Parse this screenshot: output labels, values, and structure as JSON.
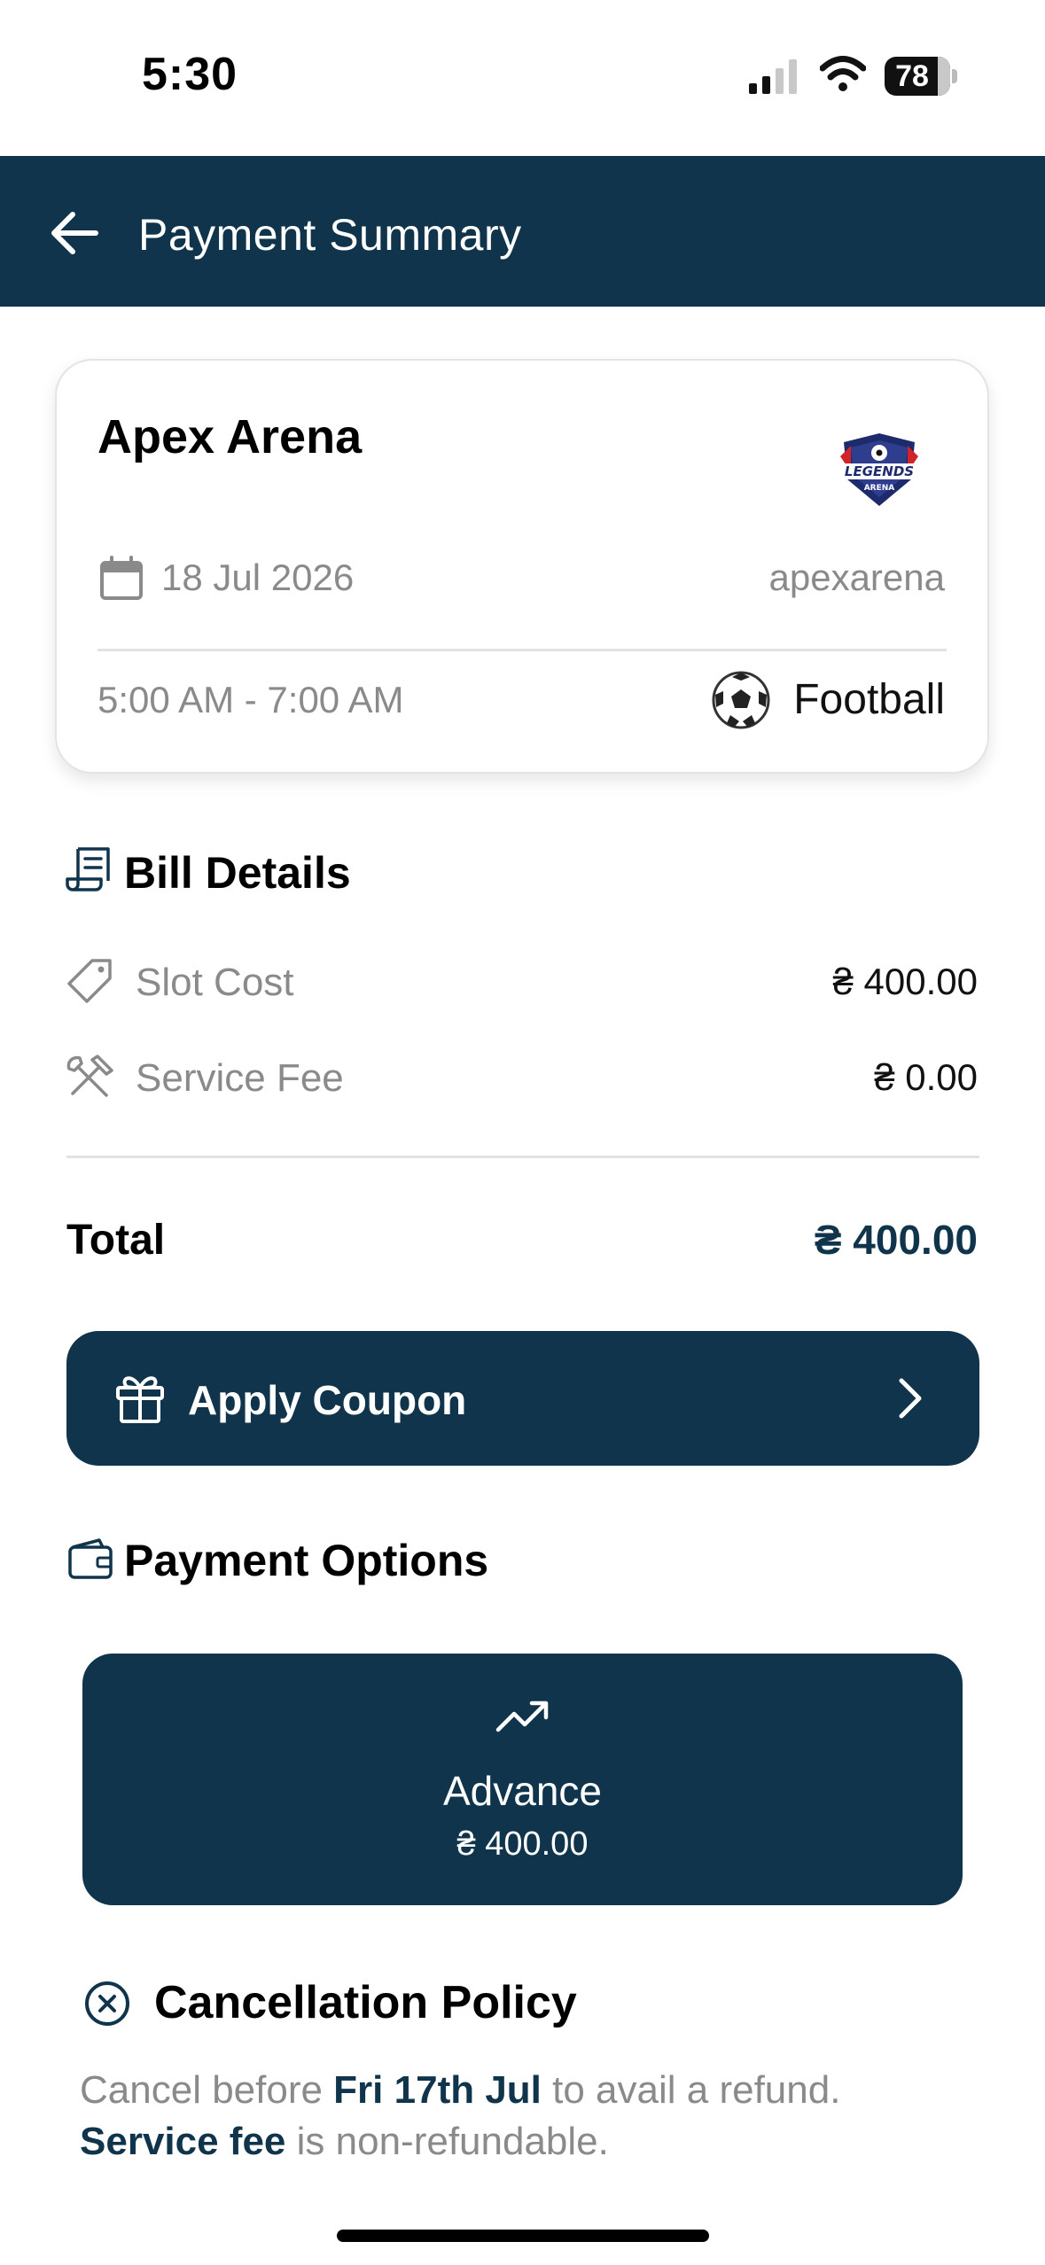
{
  "status_bar": {
    "time": "5:30",
    "battery": "78"
  },
  "header": {
    "title": "Payment Summary",
    "back_icon": "arrow-left-icon"
  },
  "venue": {
    "name": "Apex Arena",
    "logo_text": "LEGENDS ARENA",
    "date": "18 Jul 2026",
    "handle": "apexarena",
    "time_slot": "5:00 AM - 7:00 AM",
    "sport": "Football"
  },
  "bill": {
    "title": "Bill Details",
    "slot_cost_label": "Slot Cost",
    "slot_cost_value": "₴ 400.00",
    "service_fee_label": "Service Fee",
    "service_fee_value": "₴ 0.00",
    "total_label": "Total",
    "total_value": "₴ 400.00"
  },
  "coupon": {
    "label": "Apply Coupon"
  },
  "payment_options": {
    "title": "Payment Options",
    "advance_label": "Advance",
    "advance_amount": "₴ 400.00"
  },
  "cancellation": {
    "title": "Cancellation Policy",
    "line1_prefix": "Cancel before ",
    "line1_date": "Fri 17th Jul",
    "line1_suffix": " to avail a refund.",
    "line2_highlight": "Service fee",
    "line2_suffix": " is non-refundable."
  },
  "colors": {
    "primary": "#0f344b",
    "muted_text": "#8a8a8a",
    "divider": "#e2e2e2"
  }
}
